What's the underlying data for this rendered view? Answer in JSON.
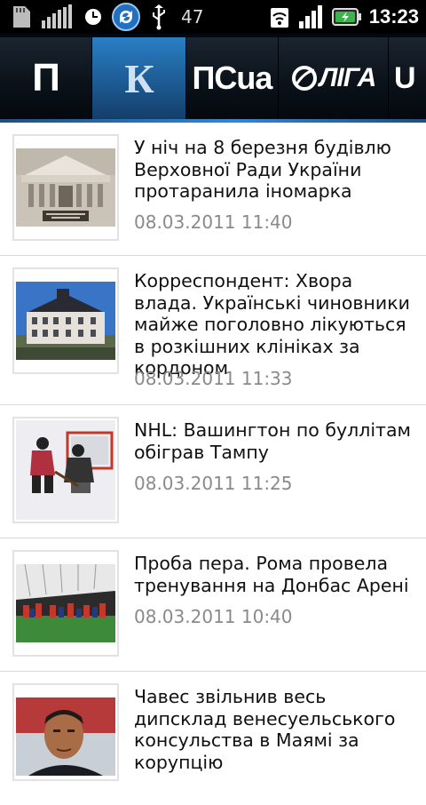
{
  "status_bar": {
    "notification_count": "47",
    "time": "13:23",
    "icons": [
      "sd-card-icon",
      "signal-bars-icon",
      "alarm-clock-icon",
      "sync-icon",
      "usb-icon",
      "wifi-icon",
      "cell-signal-icon",
      "battery-charging-icon"
    ]
  },
  "tabs": [
    {
      "logo": "П",
      "name": "pravda"
    },
    {
      "logo": "К",
      "name": "korrespondent"
    },
    {
      "logo": "ПСua",
      "name": "ps-ua"
    },
    {
      "logo": "ЛIГА",
      "name": "liga"
    },
    {
      "logo": "U",
      "name": "next-source"
    }
  ],
  "articles": [
    {
      "title": "У ніч на 8 березня будівлю Верховної Ради України протаранила іномарка",
      "date": "08.03.2011 11:40",
      "image": "parliament-building"
    },
    {
      "title": "Корреспондент: Хвора влада. Українські чиновники майже поголовно лікуються в розкішних клініках за кордоном",
      "date": "08.03.2011 11:33",
      "image": "hospital-clinic"
    },
    {
      "title": "NHL: Вашингтон по буллітам обіграв Тампу",
      "date": "08.03.2011 11:25",
      "image": "hockey-game"
    },
    {
      "title": "Проба пера. Рома провела тренування на Донбас Арені",
      "date": "08.03.2011 10:40",
      "image": "football-training"
    },
    {
      "title": "Чавес звільнив весь дипсклад венесуельського консульства в Маямі за корупцію",
      "date": "",
      "image": "chavez-portrait"
    }
  ],
  "colors": {
    "tabbar_bg": "#02080f",
    "tab_active": "#1d5b94",
    "headline_text": "#111111",
    "date_text": "#8a8a8a",
    "separator": "#d8d8d8"
  }
}
